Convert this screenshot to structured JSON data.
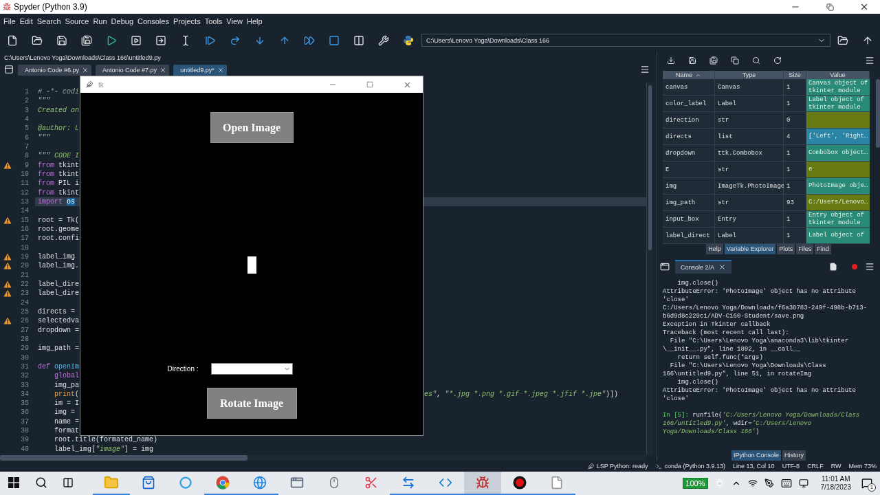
{
  "window": {
    "title": "Spyder (Python 3.9)"
  },
  "menu": [
    "File",
    "Edit",
    "Search",
    "Source",
    "Run",
    "Debug",
    "Consoles",
    "Projects",
    "Tools",
    "View",
    "Help"
  ],
  "working_directory": "C:\\Users\\Lenovo Yoga\\Downloads\\Class 166",
  "editor": {
    "file_path": "C:\\Users\\Lenovo Yoga\\Downloads\\Class 166\\untitled9.py",
    "tabs": [
      {
        "label": "Antonio Code #6.py",
        "selected": false
      },
      {
        "label": "Antonio Code #7.py",
        "selected": false
      },
      {
        "label": "untitled9.py*",
        "selected": true
      }
    ],
    "lines": [
      {
        "n": "1",
        "warning": false,
        "current": false,
        "code": [
          {
            "kind": "comment",
            "text": "# -*- codi"
          }
        ]
      },
      {
        "n": "2",
        "warning": false,
        "current": false,
        "code": [
          {
            "kind": "string",
            "text": "\"\"\""
          }
        ]
      },
      {
        "n": "3",
        "warning": false,
        "current": false,
        "code": [
          {
            "kind": "string",
            "text": "Created on"
          }
        ]
      },
      {
        "n": "4",
        "warning": false,
        "current": false
      },
      {
        "n": "5",
        "warning": false,
        "current": false,
        "code": [
          {
            "kind": "string",
            "text": "@author: L"
          }
        ]
      },
      {
        "n": "6",
        "warning": false,
        "current": false,
        "code": [
          {
            "kind": "string",
            "text": "\"\"\""
          }
        ]
      },
      {
        "n": "7",
        "warning": false,
        "current": false
      },
      {
        "n": "8",
        "warning": false,
        "current": false,
        "code": [
          {
            "kind": "string",
            "text": "\"\"\" CODE I"
          }
        ]
      },
      {
        "n": "9",
        "warning": true,
        "current": false,
        "code": [
          {
            "kind": "keyword",
            "text": "from"
          },
          {
            "kind": "plain",
            "text": " tkint"
          }
        ]
      },
      {
        "n": "10",
        "warning": false,
        "current": false,
        "code": [
          {
            "kind": "keyword",
            "text": "from"
          },
          {
            "kind": "plain",
            "text": " tkint"
          }
        ]
      },
      {
        "n": "11",
        "warning": false,
        "current": false,
        "code": [
          {
            "kind": "keyword",
            "text": "from"
          },
          {
            "kind": "plain",
            "text": " PIL i"
          }
        ]
      },
      {
        "n": "12",
        "warning": false,
        "current": false,
        "code": [
          {
            "kind": "keyword",
            "text": "from"
          },
          {
            "kind": "plain",
            "text": " tkint"
          }
        ]
      },
      {
        "n": "13",
        "warning": false,
        "current": true,
        "code": [
          {
            "kind": "keyword",
            "text": "import "
          },
          {
            "kind": "selected",
            "text": "os"
          }
        ]
      },
      {
        "n": "14",
        "warning": false,
        "current": false
      },
      {
        "n": "15",
        "warning": true,
        "current": false,
        "code": [
          {
            "kind": "plain",
            "text": "root = Tk("
          }
        ]
      },
      {
        "n": "16",
        "warning": false,
        "current": false,
        "code": [
          {
            "kind": "plain",
            "text": "root.geome"
          }
        ]
      },
      {
        "n": "17",
        "warning": false,
        "current": false,
        "code": [
          {
            "kind": "plain",
            "text": "root.confi"
          }
        ]
      },
      {
        "n": "18",
        "warning": false,
        "current": false
      },
      {
        "n": "19",
        "warning": true,
        "current": false,
        "code": [
          {
            "kind": "plain",
            "text": "label_img"
          }
        ]
      },
      {
        "n": "20",
        "warning": true,
        "current": false,
        "code": [
          {
            "kind": "plain",
            "text": "label_img."
          }
        ]
      },
      {
        "n": "21",
        "warning": false,
        "current": false
      },
      {
        "n": "22",
        "warning": true,
        "current": false,
        "code": [
          {
            "kind": "plain",
            "text": "label_dire"
          }
        ]
      },
      {
        "n": "23",
        "warning": true,
        "current": false,
        "code": [
          {
            "kind": "plain",
            "text": "label_dire"
          }
        ]
      },
      {
        "n": "24",
        "warning": false,
        "current": false
      },
      {
        "n": "25",
        "warning": false,
        "current": false,
        "code": [
          {
            "kind": "plain",
            "text": "directs ="
          }
        ]
      },
      {
        "n": "26",
        "warning": true,
        "current": false,
        "code": [
          {
            "kind": "plain",
            "text": "selectedva"
          }
        ]
      },
      {
        "n": "27",
        "warning": false,
        "current": false,
        "code": [
          {
            "kind": "plain",
            "text": "dropdown ="
          }
        ]
      },
      {
        "n": "28",
        "warning": false,
        "current": false
      },
      {
        "n": "29",
        "warning": false,
        "current": false,
        "code": [
          {
            "kind": "plain",
            "text": "img_path ="
          }
        ]
      },
      {
        "n": "30",
        "warning": false,
        "current": false
      },
      {
        "n": "31",
        "warning": false,
        "current": false,
        "code": [
          {
            "kind": "keyword",
            "text": "def "
          },
          {
            "kind": "func",
            "text": "openIm"
          }
        ]
      },
      {
        "n": "32",
        "warning": false,
        "current": false,
        "code": [
          {
            "kind": "keyword",
            "text": "    global"
          }
        ]
      },
      {
        "n": "33",
        "warning": false,
        "current": false,
        "code": [
          {
            "kind": "plain",
            "text": "    img_pa"
          }
        ]
      },
      {
        "n": "34",
        "warning": false,
        "current": false,
        "code": [
          {
            "kind": "builtin",
            "text": "    print"
          },
          {
            "kind": "plain",
            "text": "("
          }
        ],
        "right": [
          {
            "kind": "string",
            "text": "es\""
          },
          {
            "kind": "plain",
            "text": ", "
          },
          {
            "kind": "string",
            "text": "\"*.jpg *.png *.gif *.jpeg *.jfif *.jpe\""
          },
          {
            "kind": "plain",
            "text": ")])"
          }
        ]
      },
      {
        "n": "35",
        "warning": false,
        "current": false,
        "code": [
          {
            "kind": "plain",
            "text": "    im = I"
          }
        ]
      },
      {
        "n": "36",
        "warning": false,
        "current": false,
        "code": [
          {
            "kind": "plain",
            "text": "    img ="
          }
        ]
      },
      {
        "n": "37",
        "warning": false,
        "current": false,
        "code": [
          {
            "kind": "plain",
            "text": "    name ="
          }
        ]
      },
      {
        "n": "38",
        "warning": false,
        "current": false,
        "code": [
          {
            "kind": "plain",
            "text": "    format"
          }
        ]
      },
      {
        "n": "39",
        "warning": false,
        "current": false,
        "code": [
          {
            "kind": "plain",
            "text": "    root.title(formated_name)"
          }
        ]
      },
      {
        "n": "40",
        "warning": false,
        "current": false,
        "code": [
          {
            "kind": "plain",
            "text": "    label_img["
          },
          {
            "kind": "string",
            "text": "\"image\""
          },
          {
            "kind": "plain",
            "text": "] = img"
          }
        ]
      }
    ]
  },
  "tk_window": {
    "title": "tk",
    "open_button": "Open Image",
    "direction_label": "Direction :",
    "rotate_button": "Rotate Image"
  },
  "variable_explorer": {
    "columns": [
      "Name",
      "Type",
      "Size",
      "Value"
    ],
    "rows": [
      {
        "name": "canvas",
        "type": "Canvas",
        "size": "1",
        "value": "Canvas object of tkinter module",
        "color": "#2a8a78"
      },
      {
        "name": "color_label",
        "type": "Label",
        "size": "1",
        "value": "Label object of tkinter module",
        "color": "#2a8a78"
      },
      {
        "name": "direction",
        "type": "str",
        "size": "0",
        "color": "#677a12"
      },
      {
        "name": "directs",
        "type": "list",
        "size": "4",
        "value": "['Left', 'Right…",
        "color": "#2b83a6"
      },
      {
        "name": "dropdown",
        "type": "ttk.Combobox",
        "size": "1",
        "value": "Combobox object…",
        "color": "#2a8a78"
      },
      {
        "name": "E",
        "type": "str",
        "size": "1",
        "value": "e",
        "color": "#677a12"
      },
      {
        "name": "img",
        "type": "ImageTk.PhotoImage",
        "size": "1",
        "value": "PhotoImage obje…",
        "color": "#2a8a78"
      },
      {
        "name": "img_path",
        "type": "str",
        "size": "93",
        "value": "C:/Users/Lenovo…",
        "color": "#677a12"
      },
      {
        "name": "input_box",
        "type": "Entry",
        "size": "1",
        "value": "Entry object of tkinter module",
        "color": "#2a8a78"
      },
      {
        "name": "label_direct",
        "type": "Label",
        "size": "1",
        "value": "Label object of",
        "color": "#2a8a78"
      }
    ]
  },
  "top_pane_tabs": [
    {
      "label": "Help",
      "selected": false
    },
    {
      "label": "Variable Explorer",
      "selected": true
    },
    {
      "label": "Plots",
      "selected": false
    },
    {
      "label": "Files",
      "selected": false
    },
    {
      "label": "Find",
      "selected": false
    }
  ],
  "console": {
    "tab": "Console 2/A",
    "lines": [
      "    img.close()",
      "AttributeError: 'PhotoImage' object has no attribute",
      "'close'",
      "C:/Users/Lenovo Yoga/Downloads/f6a38783-249f-498b-b713-",
      "b6d9d8c229c1/ADV-C160-Student/save.png",
      "Exception in Tkinter callback",
      "Traceback (most recent call last):",
      "  File \"C:\\Users\\Lenovo Yoga\\anaconda3\\lib\\tkinter",
      "\\__init__.py\", line 1892, in __call__",
      "    return self.func(*args)",
      "  File \"C:\\Users\\Lenovo Yoga\\Downloads\\Class",
      "166\\untitled9.py\", line 51, in rotateImg",
      "    img.close()",
      "AttributeError: 'PhotoImage' object has no attribute",
      "'close'"
    ],
    "input": [
      {
        "kind": "prompt",
        "text": "In [5]: "
      },
      {
        "kind": "plain",
        "text": "runfile("
      },
      {
        "kind": "string",
        "text": "'C:/Users/Lenovo Yoga/Downloads/Class 166/untitled9.py'"
      },
      {
        "kind": "plain",
        "text": ", wdir="
      },
      {
        "kind": "string",
        "text": "'C:/Users/Lenovo Yoga/Downloads/Class 166'"
      },
      {
        "kind": "plain",
        "text": ")"
      }
    ]
  },
  "bottom_pane_tabs": [
    {
      "label": "IPython Console",
      "selected": true
    },
    {
      "label": "History",
      "selected": false
    }
  ],
  "status_bar": [
    "LSP Python: ready",
    "conda (Python 3.9.13)",
    "Line 13, Col 10",
    "UTF-8",
    "CRLF",
    "RW",
    "Mem 73%"
  ],
  "taskbar": {
    "apps": [
      {
        "kind": "explorer",
        "running": true,
        "selected": false
      },
      {
        "kind": "store",
        "running": false,
        "selected": false
      },
      {
        "kind": "cortana",
        "running": false,
        "selected": false
      },
      {
        "kind": "chrome",
        "running": true,
        "selected": false
      },
      {
        "kind": "edge",
        "running": true,
        "selected": false
      },
      {
        "kind": "window",
        "running": false,
        "selected": false
      },
      {
        "kind": "mouse",
        "running": false,
        "selected": false
      },
      {
        "kind": "snip",
        "running": false,
        "selected": false
      },
      {
        "kind": "teamviewer",
        "running": true,
        "selected": false
      },
      {
        "kind": "vscode",
        "running": true,
        "selected": false
      },
      {
        "kind": "spyder",
        "running": true,
        "selected": true
      },
      {
        "kind": "recorder",
        "running": true,
        "selected": false
      },
      {
        "kind": "notepad",
        "running": true,
        "selected": false
      }
    ],
    "battery": "100%",
    "time": "11:01 AM",
    "date": "7/18/2023",
    "notifications": "1"
  }
}
